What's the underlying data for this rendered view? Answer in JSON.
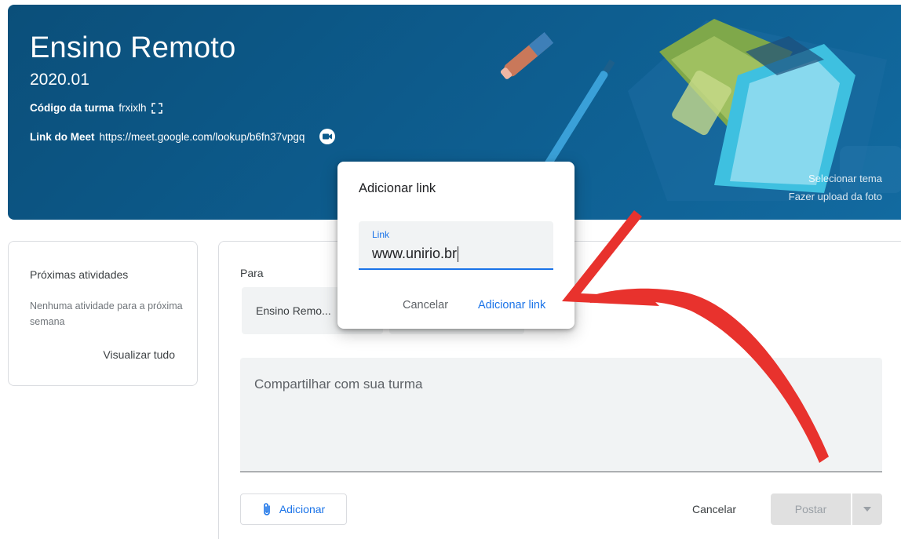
{
  "banner": {
    "title": "Ensino Remoto",
    "subtitle": "2020.01",
    "class_code_label": "Código da turma",
    "class_code": "frxixlh",
    "meet_label": "Link do Meet",
    "meet_url": "https://meet.google.com/lookup/b6fn37vpgq",
    "select_theme": "Selecionar tema",
    "upload_photo": "Fazer upload da foto",
    "color": "#0d5b8c"
  },
  "upcoming": {
    "heading": "Próximas atividades",
    "empty_text": "Nenhuma atividade para a próxima semana",
    "view_all": "Visualizar tudo"
  },
  "composer": {
    "for_label": "Para",
    "class_selected": "Ensino Remo...",
    "share_placeholder": "Compartilhar com sua turma",
    "add_button": "Adicionar",
    "cancel_button": "Cancelar",
    "post_button": "Postar"
  },
  "dialog": {
    "title": "Adicionar link",
    "field_label": "Link",
    "field_value": "www.unirio.br",
    "cancel": "Cancelar",
    "confirm": "Adicionar link"
  },
  "colors": {
    "accent": "#1a73e8",
    "annotation_arrow": "#e8322d"
  },
  "icons": {
    "copy": "fullscreen-bracket-icon",
    "meet": "video-camera-icon",
    "attach": "paperclip-icon",
    "dropdown": "triangle-down-icon"
  }
}
